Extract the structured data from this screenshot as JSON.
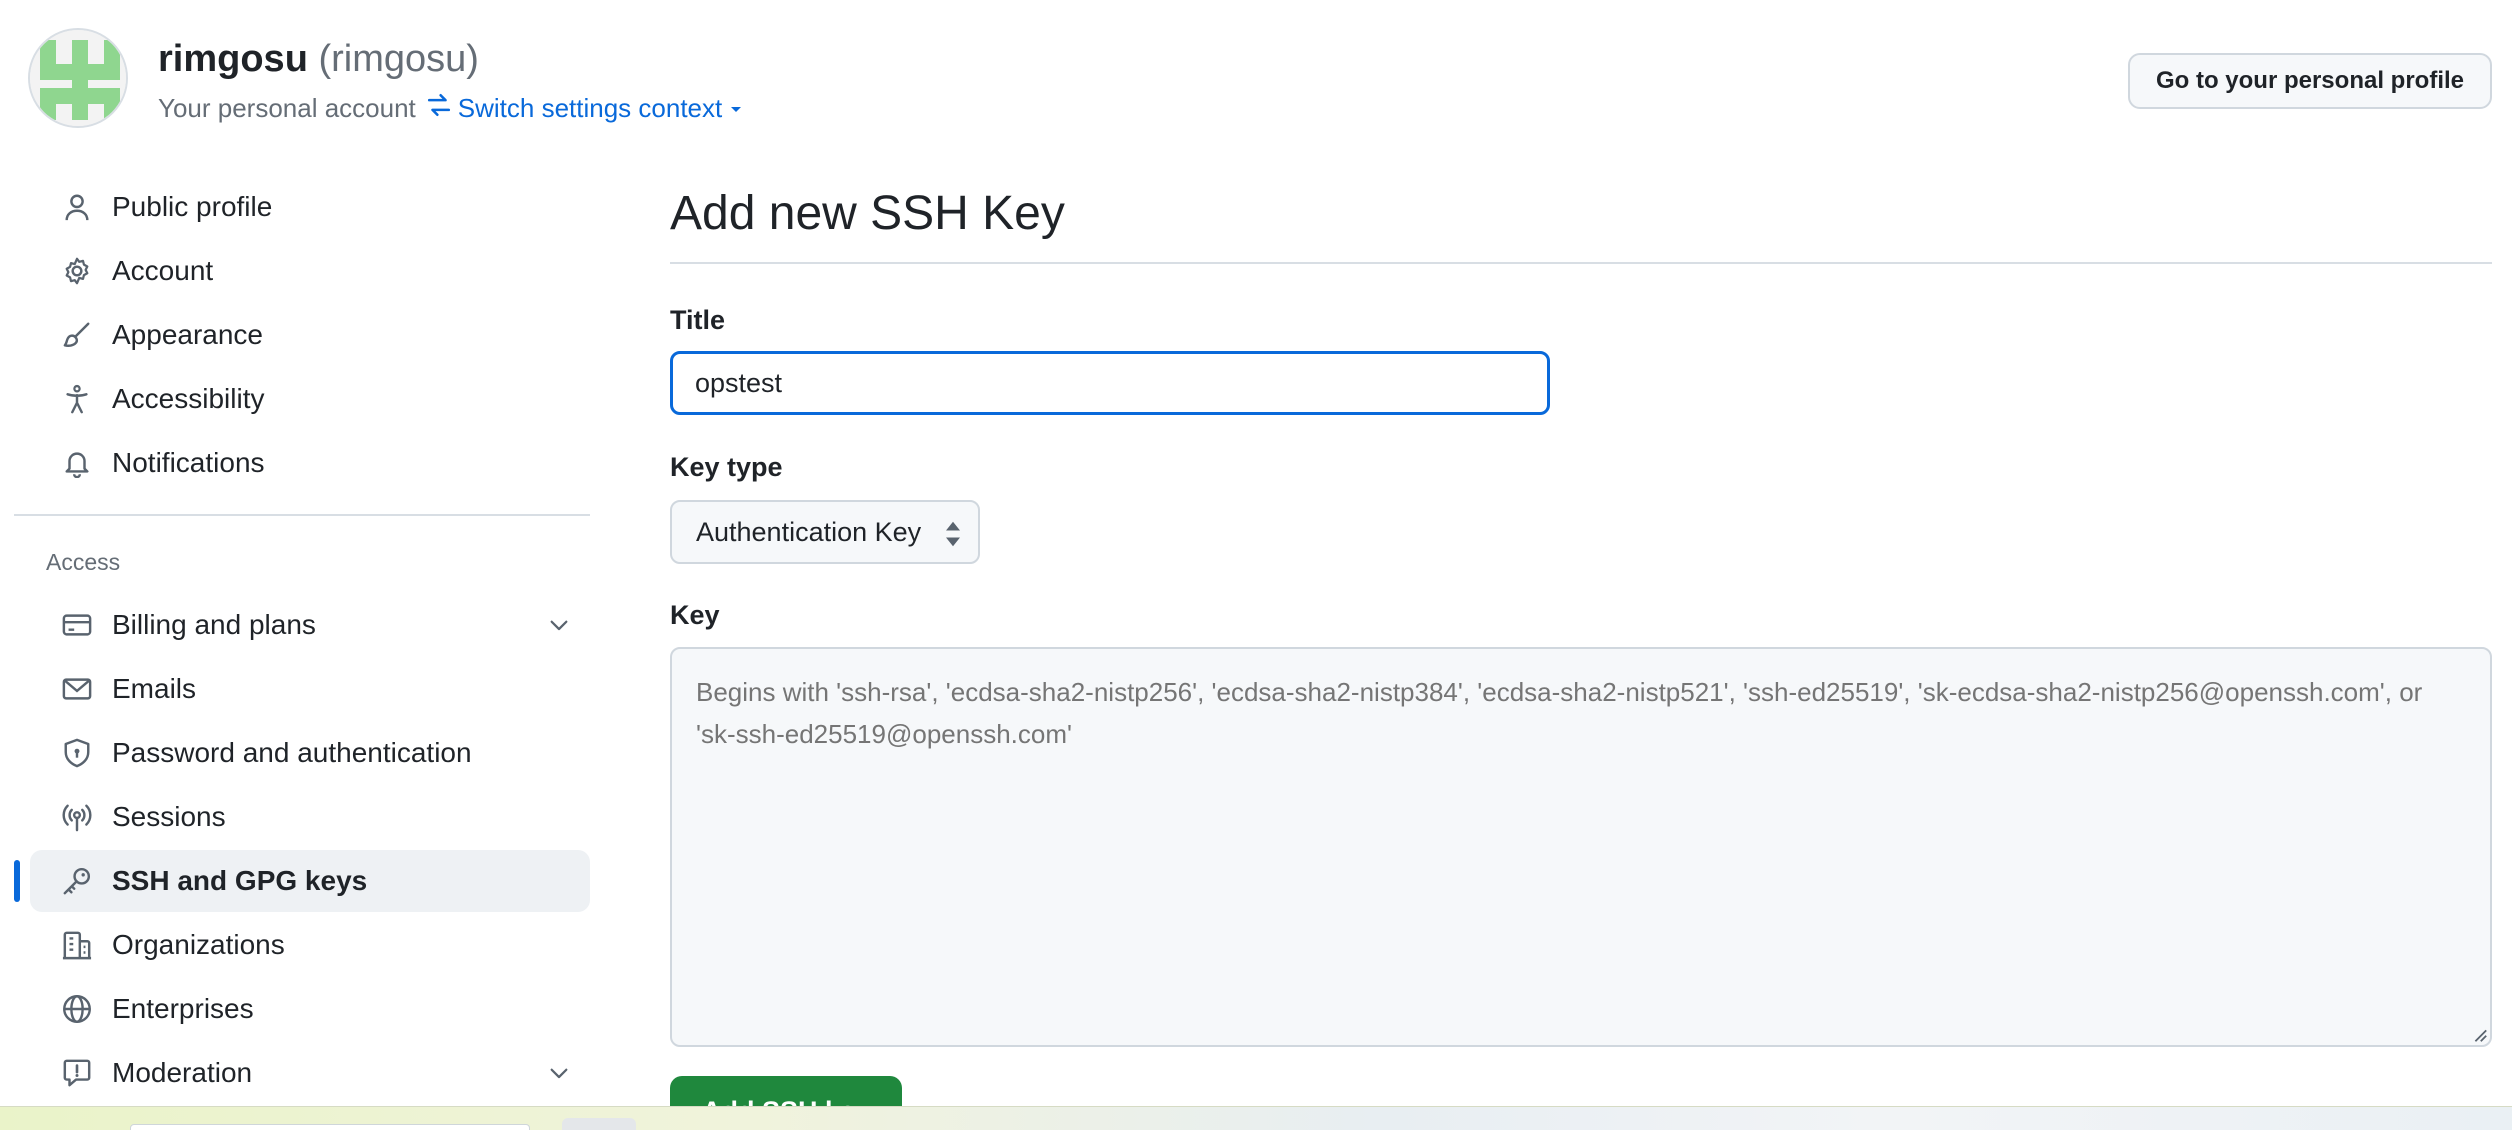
{
  "header": {
    "display_name": "rimgosu",
    "username": "(rimgosu)",
    "account_type": "Your personal account",
    "switch_context": "Switch settings context",
    "profile_button": "Go to your personal profile"
  },
  "sidebar": {
    "items_top": [
      {
        "label": "Public profile",
        "icon": "person-icon"
      },
      {
        "label": "Account",
        "icon": "gear-icon"
      },
      {
        "label": "Appearance",
        "icon": "paintbrush-icon"
      },
      {
        "label": "Accessibility",
        "icon": "accessibility-icon"
      },
      {
        "label": "Notifications",
        "icon": "bell-icon"
      }
    ],
    "access_label": "Access",
    "items_access": [
      {
        "label": "Billing and plans",
        "icon": "credit-card-icon",
        "expandable": true
      },
      {
        "label": "Emails",
        "icon": "mail-icon"
      },
      {
        "label": "Password and authentication",
        "icon": "shield-lock-icon"
      },
      {
        "label": "Sessions",
        "icon": "broadcast-icon"
      },
      {
        "label": "SSH and GPG keys",
        "icon": "key-icon",
        "active": true
      },
      {
        "label": "Organizations",
        "icon": "organization-icon"
      },
      {
        "label": "Enterprises",
        "icon": "globe-icon"
      },
      {
        "label": "Moderation",
        "icon": "report-icon",
        "expandable": true
      }
    ]
  },
  "form": {
    "page_title": "Add new SSH Key",
    "title_label": "Title",
    "title_value": "opstest",
    "key_type_label": "Key type",
    "key_type_value": "Authentication Key",
    "key_label": "Key",
    "key_placeholder": "Begins with 'ssh-rsa', 'ecdsa-sha2-nistp256', 'ecdsa-sha2-nistp384', 'ecdsa-sha2-nistp521', 'ssh-ed25519', 'sk-ecdsa-sha2-nistp256@openssh.com', or 'sk-ssh-ed25519@openssh.com'",
    "submit_label": "Add SSH key"
  },
  "colors": {
    "accent": "#0969da",
    "primary_button": "#1f883d",
    "avatar_green": "#8fd68f"
  }
}
